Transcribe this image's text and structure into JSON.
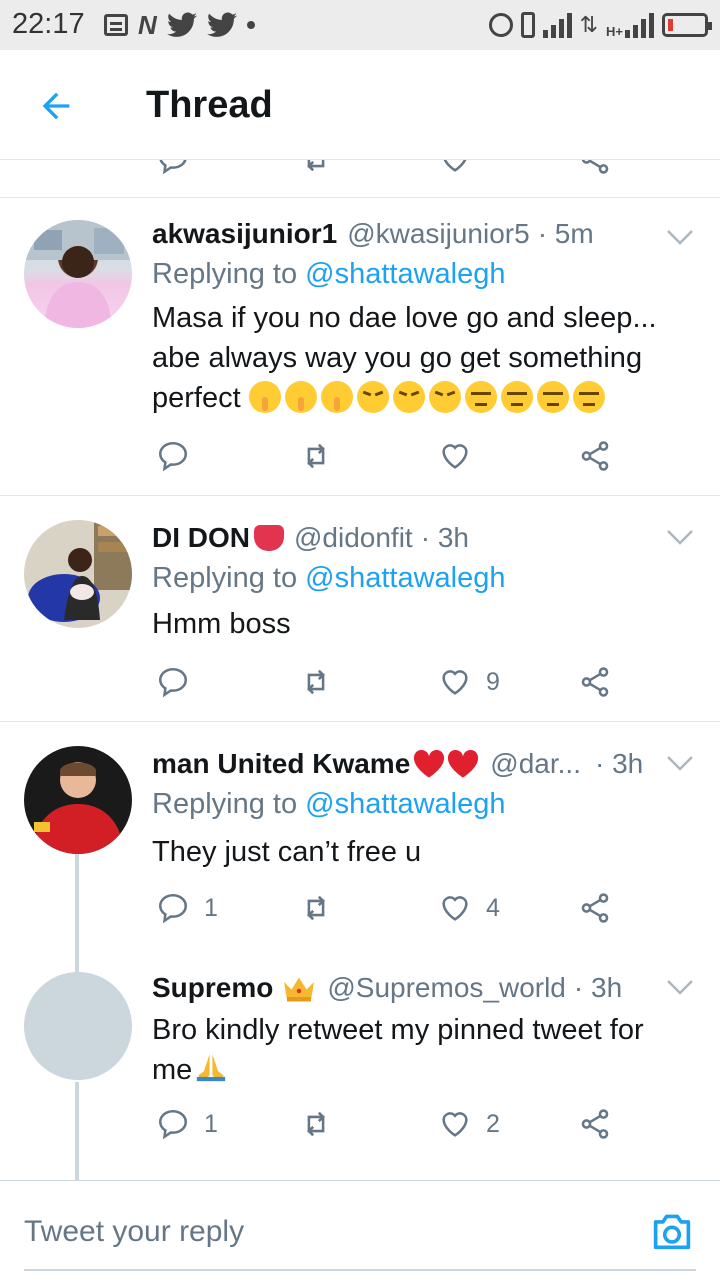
{
  "status_bar": {
    "time": "22:17",
    "left_icons": [
      "notes-icon",
      "n-app-icon",
      "twitter-icon",
      "twitter-icon",
      "dot-icon"
    ],
    "right_icons": [
      "alarm-icon",
      "vibrate-icon",
      "signal-icon",
      "data-arrows-icon",
      "hplus-signal-icon",
      "battery-icon"
    ],
    "network_label": "H+"
  },
  "header": {
    "title": "Thread",
    "back_icon": "arrow-left-icon"
  },
  "colors": {
    "accent": "#1da1f2",
    "secondary_text": "#657786",
    "primary_text": "#14171a"
  },
  "tweets": [
    {
      "name": "akwasijunior1",
      "handle": "@kwasijunior5",
      "time": "· 5m",
      "replying_prefix": "Replying to ",
      "replying_to": "@shattawalegh",
      "text": "Masa if you no dae love go and sleep... abe always way you go get something perfect",
      "emojis": [
        "shushing-face",
        "shushing-face",
        "shushing-face",
        "angry-face",
        "angry-face",
        "angry-face",
        "unamused-face",
        "unamused-face",
        "unamused-face",
        "unamused-face"
      ],
      "reply_count": "",
      "like_count": ""
    },
    {
      "name": "DI DON",
      "name_emoji": "tongue-emoji",
      "handle": "@didonfit",
      "time": "· 3h",
      "replying_prefix": "Replying to ",
      "replying_to": "@shattawalegh",
      "text": "Hmm boss",
      "reply_count": "",
      "like_count": "9"
    },
    {
      "name": "man United Kwame",
      "name_emoji": "red-heart-emoji",
      "handle": "@dar...",
      "time": "· 3h",
      "replying_prefix": "Replying to ",
      "replying_to": "@shattawalegh",
      "text": "They just can’t free u",
      "reply_count": "1",
      "like_count": "4"
    },
    {
      "name": "Supremo",
      "name_emoji": "crown-emoji",
      "handle": "@Supremos_world",
      "time": "· 3h",
      "text": "Bro kindly retweet my pinned tweet for me",
      "text_emoji": "folded-hands-emoji",
      "reply_count": "1",
      "like_count": "2"
    }
  ],
  "composer": {
    "placeholder": "Tweet your reply",
    "camera_icon": "camera-icon"
  }
}
